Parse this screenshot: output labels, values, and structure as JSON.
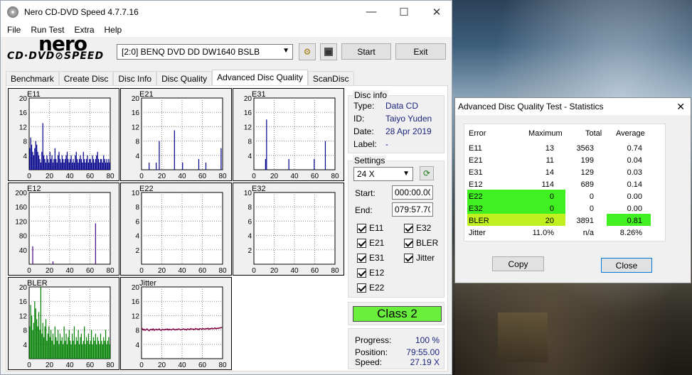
{
  "window": {
    "title": "Nero CD-DVD Speed 4.7.7.16"
  },
  "menu": [
    "File",
    "Run Test",
    "Extra",
    "Help"
  ],
  "logo": {
    "line1": "nero",
    "line2": "CD·DVD⊘SPEED"
  },
  "drive": {
    "value": "[2:0]   BENQ DVD DD DW1640 BSLB"
  },
  "buttons": {
    "start": "Start",
    "exit": "Exit"
  },
  "tabs": [
    "Benchmark",
    "Create Disc",
    "Disc Info",
    "Disc Quality",
    "Advanced Disc Quality",
    "ScanDisc"
  ],
  "charts": {
    "E11": {
      "label": "E11",
      "yticks": [
        "20",
        "16",
        "12",
        "8",
        "4"
      ],
      "xticks": [
        "0",
        "20",
        "40",
        "60",
        "80"
      ]
    },
    "E21": {
      "label": "E21",
      "yticks": [
        "20",
        "16",
        "12",
        "8",
        "4"
      ],
      "xticks": [
        "0",
        "20",
        "40",
        "60",
        "80"
      ]
    },
    "E31": {
      "label": "E31",
      "yticks": [
        "20",
        "16",
        "12",
        "8",
        "4"
      ],
      "xticks": [
        "0",
        "20",
        "40",
        "60",
        "80"
      ]
    },
    "E12": {
      "label": "E12",
      "yticks": [
        "200",
        "160",
        "120",
        "80",
        "40"
      ],
      "xticks": [
        "0",
        "20",
        "40",
        "60",
        "80"
      ]
    },
    "E22": {
      "label": "E22",
      "yticks": [
        "10",
        "8",
        "6",
        "4",
        "2"
      ],
      "xticks": [
        "0",
        "20",
        "40",
        "60",
        "80"
      ]
    },
    "E32": {
      "label": "E32",
      "yticks": [
        "10",
        "8",
        "6",
        "4",
        "2"
      ],
      "xticks": [
        "0",
        "20",
        "40",
        "60",
        "80"
      ]
    },
    "BLER": {
      "label": "BLER",
      "yticks": [
        "20",
        "16",
        "12",
        "8",
        "4"
      ],
      "xticks": [
        "0",
        "20",
        "40",
        "60",
        "80"
      ]
    },
    "Jitter": {
      "label": "Jitter",
      "yticks": [
        "20",
        "16",
        "12",
        "8",
        "4"
      ],
      "xticks": [
        "0",
        "20",
        "40",
        "60",
        "80"
      ]
    }
  },
  "chart_data": [
    {
      "type": "bar",
      "title": "E11",
      "ylim": [
        0,
        20
      ],
      "xlim": [
        0,
        80
      ],
      "color": "#00008b",
      "values": [
        6,
        9,
        7,
        5,
        4,
        6,
        8,
        7,
        5,
        4,
        3,
        2,
        5,
        13,
        4,
        3,
        2,
        4,
        3,
        2,
        5,
        3,
        4,
        2,
        3,
        6,
        3,
        2,
        4,
        5,
        3,
        2,
        4,
        3,
        2,
        3,
        4,
        5,
        3,
        2,
        3,
        4,
        2,
        3,
        2,
        4,
        5,
        3,
        2,
        3,
        4,
        3,
        2,
        5,
        3,
        2,
        3,
        4,
        2,
        3,
        3,
        2,
        4,
        3,
        2,
        3,
        4,
        5,
        3,
        2,
        3,
        3,
        2,
        4,
        3,
        2,
        3,
        2,
        3,
        2
      ]
    },
    {
      "type": "bar",
      "title": "E21",
      "ylim": [
        0,
        20
      ],
      "xlim": [
        0,
        80
      ],
      "color": "#00008b",
      "values": [
        0,
        0,
        0,
        0,
        0,
        0,
        0,
        2,
        0,
        0,
        0,
        0,
        0,
        0,
        2,
        0,
        0,
        8,
        0,
        0,
        0,
        0,
        0,
        0,
        0,
        0,
        0,
        0,
        0,
        0,
        0,
        0,
        11,
        0,
        0,
        0,
        0,
        0,
        0,
        0,
        2,
        0,
        0,
        0,
        0,
        0,
        0,
        0,
        0,
        0,
        0,
        0,
        0,
        0,
        0,
        0,
        3,
        0,
        0,
        0,
        0,
        0,
        0,
        2,
        0,
        0,
        0,
        0,
        0,
        0,
        0,
        0,
        0,
        0,
        0,
        0,
        0,
        0,
        6,
        0
      ]
    },
    {
      "type": "bar",
      "title": "E31",
      "ylim": [
        0,
        20
      ],
      "xlim": [
        0,
        80
      ],
      "color": "#00008b",
      "values": [
        0,
        0,
        0,
        0,
        0,
        0,
        0,
        0,
        0,
        0,
        0,
        3,
        14,
        0,
        0,
        0,
        0,
        0,
        0,
        0,
        0,
        0,
        0,
        0,
        0,
        0,
        0,
        0,
        0,
        0,
        0,
        0,
        0,
        0,
        3,
        0,
        0,
        0,
        0,
        0,
        0,
        0,
        0,
        0,
        0,
        0,
        0,
        0,
        0,
        0,
        0,
        0,
        0,
        0,
        0,
        0,
        0,
        0,
        0,
        3,
        0,
        0,
        0,
        0,
        0,
        0,
        0,
        0,
        0,
        0,
        8,
        0,
        0,
        0,
        0,
        0,
        0,
        0,
        0,
        0
      ]
    },
    {
      "type": "bar",
      "title": "E12",
      "ylim": [
        0,
        200
      ],
      "xlim": [
        0,
        80
      ],
      "color": "#4b0082",
      "values": [
        0,
        0,
        0,
        50,
        0,
        0,
        0,
        0,
        0,
        0,
        0,
        0,
        0,
        0,
        0,
        0,
        0,
        0,
        0,
        0,
        0,
        0,
        0,
        8,
        0,
        0,
        0,
        0,
        0,
        0,
        0,
        0,
        0,
        0,
        0,
        0,
        0,
        0,
        0,
        0,
        0,
        0,
        0,
        0,
        0,
        0,
        0,
        0,
        0,
        0,
        0,
        0,
        0,
        0,
        0,
        0,
        0,
        0,
        0,
        0,
        0,
        0,
        0,
        0,
        0,
        114,
        0,
        0,
        0,
        0,
        0,
        0,
        0,
        0,
        0,
        0,
        0,
        0,
        0,
        0
      ]
    },
    {
      "type": "bar",
      "title": "E22",
      "ylim": [
        0,
        10
      ],
      "xlim": [
        0,
        80
      ],
      "color": "#00008b",
      "values": []
    },
    {
      "type": "bar",
      "title": "E32",
      "ylim": [
        0,
        10
      ],
      "xlim": [
        0,
        80
      ],
      "color": "#00008b",
      "values": []
    },
    {
      "type": "bar",
      "title": "BLER",
      "ylim": [
        0,
        20
      ],
      "xlim": [
        0,
        80
      ],
      "color": "#008000",
      "values": [
        9,
        15,
        12,
        8,
        10,
        16,
        14,
        11,
        9,
        13,
        8,
        20,
        7,
        10,
        6,
        9,
        11,
        5,
        7,
        9,
        6,
        8,
        5,
        7,
        4,
        9,
        6,
        5,
        8,
        4,
        7,
        5,
        6,
        4,
        9,
        5,
        7,
        4,
        6,
        8,
        5,
        4,
        7,
        5,
        9,
        4,
        6,
        5,
        8,
        4,
        6,
        7,
        4,
        5,
        9,
        4,
        6,
        5,
        7,
        4,
        5,
        8,
        4,
        6,
        5,
        7,
        4,
        6,
        5,
        4,
        7,
        5,
        4,
        6,
        5,
        8,
        4,
        5,
        6,
        4
      ]
    },
    {
      "type": "line",
      "title": "Jitter",
      "ylim": [
        0,
        20
      ],
      "xlim": [
        0,
        80
      ],
      "color": "#800040",
      "values": [
        8.5,
        8.0,
        8.2,
        7.9,
        8.1,
        8.3,
        8.0,
        7.8,
        8.1,
        8.2,
        8.0,
        8.3,
        7.9,
        8.1,
        8.2,
        8.0,
        8.1,
        8.3,
        8.0,
        7.9,
        8.2,
        8.1,
        8.0,
        8.2,
        8.1,
        8.3,
        8.0,
        8.2,
        8.1,
        8.0,
        8.2,
        8.3,
        8.1,
        8.0,
        8.2,
        8.1,
        8.3,
        8.2,
        8.0,
        8.1,
        8.2,
        8.3,
        8.1,
        8.2,
        8.0,
        8.3,
        8.2,
        8.1,
        8.4,
        8.2,
        8.3,
        8.1,
        8.2,
        8.4,
        8.2,
        8.3,
        8.1,
        8.4,
        8.3,
        8.2,
        8.4,
        8.3,
        8.2,
        8.4,
        8.3,
        8.5,
        8.2,
        8.4,
        8.3,
        8.5,
        8.3,
        8.4,
        8.6,
        8.3,
        8.5,
        8.4,
        8.6,
        8.5,
        8.7,
        8.6
      ]
    }
  ],
  "disc_info": {
    "title": "Disc info",
    "type_label": "Type:",
    "type": "Data CD",
    "id_label": "ID:",
    "id": "Taiyo Yuden",
    "date_label": "Date:",
    "date": "28 Apr 2019",
    "label_label": "Label:",
    "label": "-"
  },
  "settings": {
    "title": "Settings",
    "speed": "24 X",
    "start_label": "Start:",
    "start": "000:00.00",
    "end_label": "End:",
    "end": "079:57.70",
    "checks": [
      "E11",
      "E21",
      "E31",
      "E12",
      "E22",
      "E32",
      "BLER",
      "Jitter"
    ]
  },
  "class": "Class 2",
  "progress": {
    "progress_label": "Progress:",
    "progress": "100 %",
    "position_label": "Position:",
    "position": "79:55.00",
    "speed_label": "Speed:",
    "speed": "27.19 X"
  },
  "stats": {
    "title": "Advanced Disc Quality Test - Statistics",
    "headers": [
      "Error",
      "Maximum",
      "Total",
      "Average"
    ],
    "rows": [
      [
        "E11",
        "13",
        "3563",
        "0.74"
      ],
      [
        "E21",
        "11",
        "199",
        "0.04"
      ],
      [
        "E31",
        "14",
        "129",
        "0.03"
      ],
      [
        "E12",
        "114",
        "689",
        "0.14"
      ],
      [
        "E22",
        "0",
        "0",
        "0.00"
      ],
      [
        "E32",
        "0",
        "0",
        "0.00"
      ],
      [
        "BLER",
        "20",
        "3891",
        "0.81"
      ],
      [
        "Jitter",
        "11.0%",
        "n/a",
        "8.26%"
      ]
    ],
    "copy": "Copy",
    "close": "Close"
  }
}
